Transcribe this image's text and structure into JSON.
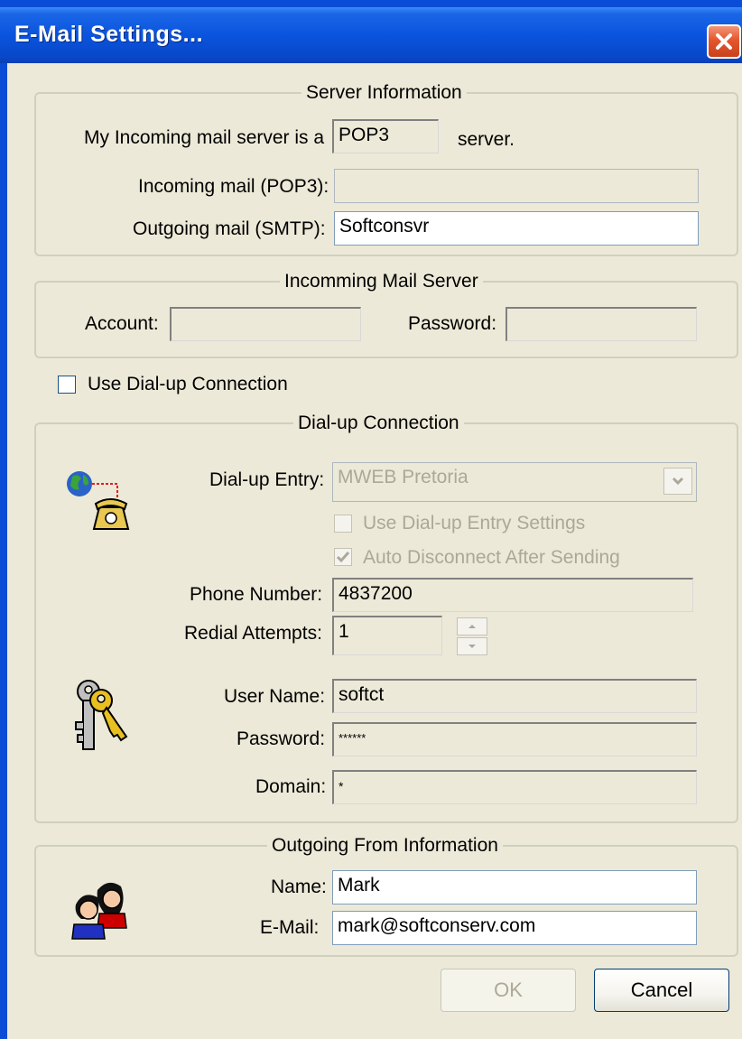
{
  "window": {
    "title": "E-Mail Settings..."
  },
  "server_info": {
    "title": "Server Information",
    "incoming_type_label": "My Incoming mail server is a",
    "incoming_type_value": "POP3",
    "incoming_type_suffix": "server.",
    "incoming_label": "Incoming mail (POP3):",
    "incoming_value": "",
    "outgoing_label": "Outgoing mail (SMTP):",
    "outgoing_value": "Softconsvr"
  },
  "incoming_server": {
    "title": "Incomming Mail Server",
    "account_label": "Account:",
    "account_value": "",
    "password_label": "Password:",
    "password_value": ""
  },
  "dialup_toggle": {
    "label": "Use Dial-up Connection",
    "checked": false
  },
  "dialup": {
    "title": "Dial-up Connection",
    "entry_label": "Dial-up Entry:",
    "entry_value": "MWEB Pretoria",
    "use_entry_settings_label": "Use Dial-up Entry Settings",
    "auto_disconnect_label": "Auto Disconnect After Sending",
    "phone_label": "Phone Number:",
    "phone_value": "4837200",
    "redial_label": "Redial Attempts:",
    "redial_value": "1",
    "username_label": "User Name:",
    "username_value": "softct",
    "password_label": "Password:",
    "password_value": "******",
    "domain_label": "Domain:",
    "domain_value": "*"
  },
  "outgoing_from": {
    "title": "Outgoing From Information",
    "name_label": "Name:",
    "name_value": "Mark",
    "email_label": "E-Mail:",
    "email_value": "mark@softconserv.com"
  },
  "buttons": {
    "ok": "OK",
    "cancel": "Cancel"
  },
  "icons": {
    "close": "close-icon",
    "dialup": "dialup-phone-icon",
    "keys": "keys-icon",
    "users": "users-icon"
  }
}
